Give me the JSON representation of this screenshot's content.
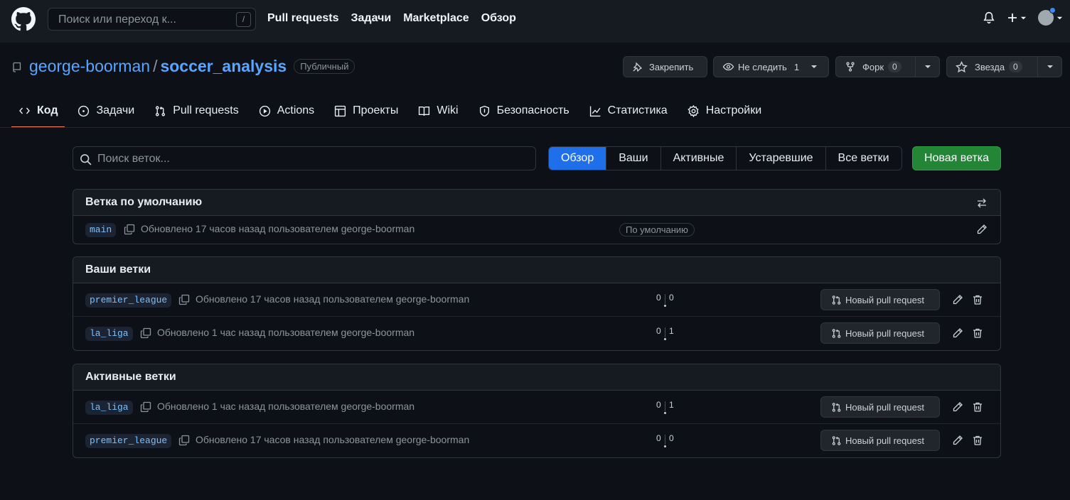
{
  "header": {
    "search_placeholder": "Поиск или переход к...",
    "search_key": "/",
    "nav": [
      "Pull requests",
      "Задачи",
      "Marketplace",
      "Обзор"
    ]
  },
  "repo": {
    "owner": "george-boorman",
    "separator": "/",
    "name": "soccer_analysis",
    "visibility": "Публичный",
    "pin_label": "Закрепить",
    "watch_label": "Не следить",
    "watch_count": "1",
    "fork_label": "Форк",
    "fork_count": "0",
    "star_label": "Звезда",
    "star_count": "0"
  },
  "repo_nav": [
    {
      "label": "Код",
      "icon": "code-icon"
    },
    {
      "label": "Задачи",
      "icon": "issue-icon"
    },
    {
      "label": "Pull requests",
      "icon": "pull-request-icon"
    },
    {
      "label": "Actions",
      "icon": "play-icon"
    },
    {
      "label": "Проекты",
      "icon": "table-icon"
    },
    {
      "label": "Wiki",
      "icon": "book-icon"
    },
    {
      "label": "Безопасность",
      "icon": "shield-icon"
    },
    {
      "label": "Статистика",
      "icon": "graph-icon"
    },
    {
      "label": "Настройки",
      "icon": "gear-icon"
    }
  ],
  "filters": {
    "search_placeholder": "Поиск веток...",
    "tabs": [
      "Обзор",
      "Ваши",
      "Активные",
      "Устаревшие",
      "Все ветки"
    ],
    "new_branch": "Новая ветка"
  },
  "default_section": {
    "title": "Ветка по умолчанию",
    "branch": "main",
    "updated": "Обновлено 17 часов назад пользователем george-boorman",
    "badge": "По умолчанию"
  },
  "your_section": {
    "title": "Ваши ветки",
    "rows": [
      {
        "branch": "premier_league",
        "updated": "Обновлено 17 часов назад пользователем george-boorman",
        "behind": "0",
        "ahead": "0",
        "pr": "Новый pull request"
      },
      {
        "branch": "la_liga",
        "updated": "Обновлено 1 час назад пользователем george-boorman",
        "behind": "0",
        "ahead": "1",
        "pr": "Новый pull request"
      }
    ]
  },
  "active_section": {
    "title": "Активные ветки",
    "rows": [
      {
        "branch": "la_liga",
        "updated": "Обновлено 1 час назад пользователем george-boorman",
        "behind": "0",
        "ahead": "1",
        "pr": "Новый pull request"
      },
      {
        "branch": "premier_league",
        "updated": "Обновлено 17 часов назад пользователем george-boorman",
        "behind": "0",
        "ahead": "0",
        "pr": "Новый pull request"
      }
    ]
  },
  "colors": {
    "accent": "#1f6feb",
    "success": "#238636",
    "link": "#58a6ff",
    "tab_underline": "#f78166"
  }
}
